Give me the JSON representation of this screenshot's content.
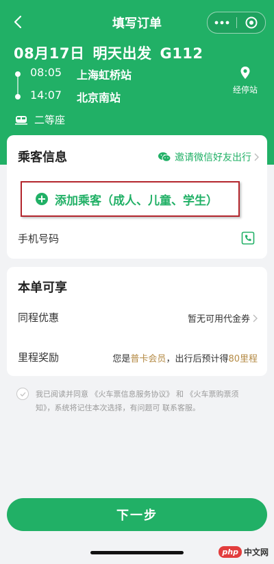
{
  "nav": {
    "title": "填写订单"
  },
  "trip": {
    "date": "08月17日",
    "day": "明天出发",
    "train": "G112",
    "depart_time": "08:05",
    "depart_station": "上海虹桥站",
    "arrive_time": "14:07",
    "arrive_station": "北京南站",
    "stopover_label": "经停站",
    "seat_type": "二等座"
  },
  "passenger": {
    "title": "乘客信息",
    "invite_label": "邀请微信好友出行",
    "add_label": "添加乘客（成人、儿童、学生）",
    "phone_label": "手机号码"
  },
  "benefits": {
    "title": "本单可享",
    "discount_label": "同程优惠",
    "discount_value": "暂无可用代金券",
    "mileage_label": "里程奖励",
    "mileage_prefix": "您是",
    "mileage_member": "普卡会员",
    "mileage_mid": "，出行后预计得",
    "mileage_points": "80里程"
  },
  "agreement": {
    "text_1": "我已阅读并同意",
    "doc_1": "《火车票信息服务协议》",
    "and": "和",
    "doc_2": "《火车票购票须知》",
    "text_2": "，系统将记住本次选择，有问题可",
    "contact": "联系客服",
    "end": "。"
  },
  "footer": {
    "next_label": "下一步"
  },
  "watermark": {
    "badge": "php",
    "text": "中文网"
  },
  "colors": {
    "brand_green": "#21b066",
    "highlight_red": "#b3252c",
    "member_gold": "#b48a44"
  }
}
